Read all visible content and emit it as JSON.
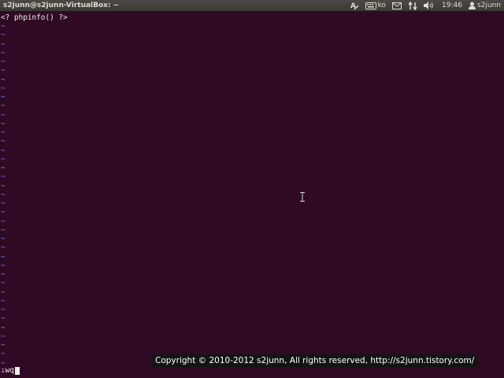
{
  "panel": {
    "window_title": "s2junn@s2junn-VirtualBox: ~",
    "keyboard_layout": "ko",
    "clock": "19:46",
    "username": "s2junn",
    "icons": [
      "text-entry-icon",
      "keyboard-icon",
      "mail-icon",
      "network-icon",
      "volume-icon",
      "user-icon"
    ]
  },
  "editor": {
    "lines": [
      "<? phpinfo() ?>"
    ],
    "empty_line_marker": "~",
    "empty_line_count": 40,
    "command_line": ":wq"
  },
  "watermark": {
    "text": "Copyright © 2010-2012 s2junn, All rights reserved, http://s2junn.tistory.com/"
  },
  "colors": {
    "terminal_bg": "#300a24",
    "panel_bg": "#3c3b37",
    "tilde": "#7a7cf4",
    "text": "#eeeeec"
  }
}
